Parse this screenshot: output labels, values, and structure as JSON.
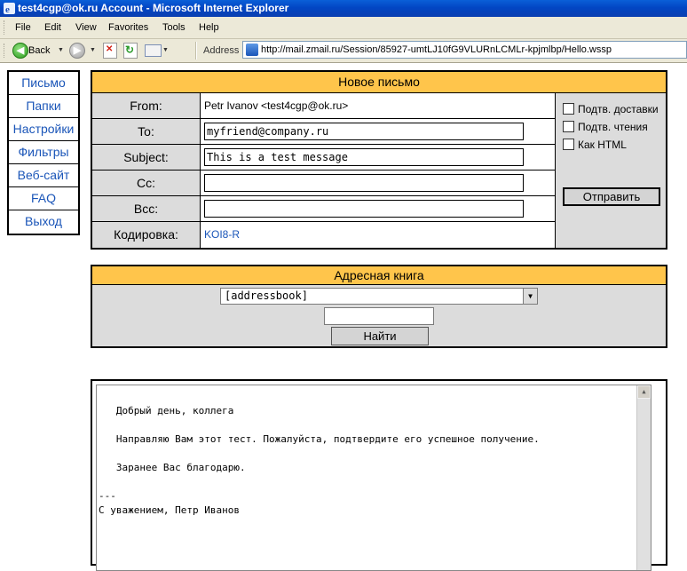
{
  "window": {
    "title": "test4cgp@ok.ru Account - Microsoft Internet Explorer"
  },
  "menu": [
    "File",
    "Edit",
    "View",
    "Favorites",
    "Tools",
    "Help"
  ],
  "toolbar": {
    "back_label": "Back",
    "address_label": "Address",
    "url": "http://mail.zmail.ru/Session/85927-umtLJ10fG9VLURnLCMLr-kpjmlbp/Hello.wssp"
  },
  "nav": [
    "Письмо",
    "Папки",
    "Настройки",
    "Фильтры",
    "Веб-сайт",
    "FAQ",
    "Выход"
  ],
  "compose": {
    "heading": "Новое письмо",
    "from_label": "From:",
    "from_value": "Petr Ivanov <test4cgp@ok.ru>",
    "to_label": "To:",
    "to_value": "myfriend@company.ru",
    "subject_label": "Subject:",
    "subject_value": "This is a test message",
    "cc_label": "Cc:",
    "cc_value": "",
    "bcc_label": "Bcc:",
    "bcc_value": "",
    "encoding_label": "Кодировка:",
    "encoding_value": "KOI8-R",
    "options": [
      {
        "label": "Подтв. доставки",
        "checked": false
      },
      {
        "label": "Подтв. чтения",
        "checked": false
      },
      {
        "label": "Как HTML",
        "checked": false
      }
    ],
    "send_label": "Отправить"
  },
  "addressbook": {
    "heading": "Адресная книга",
    "selected": "[addressbook]",
    "search_value": "",
    "find_label": "Найти"
  },
  "message": {
    "lines": [
      "   Добрый день, коллега",
      "",
      "   Направляю Вам этот тест. Пожалуйста, подтвердите его успешное получение.",
      "",
      "   Заранее Вас благодарю.",
      "",
      "---",
      "С уважением, Петр Иванов"
    ]
  }
}
